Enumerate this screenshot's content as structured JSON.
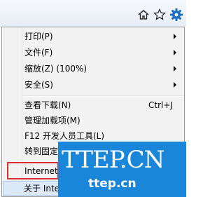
{
  "toolbar": {
    "icons": [
      "home-icon",
      "star-icon",
      "gear-icon"
    ]
  },
  "menu": {
    "items": [
      {
        "label": "打印(P)",
        "shortcut": "",
        "submenu": true
      },
      {
        "label": "文件(F)",
        "shortcut": "",
        "submenu": true
      },
      {
        "label": "缩放(Z) (100%)",
        "shortcut": "",
        "submenu": true
      },
      {
        "label": "安全(S)",
        "shortcut": "",
        "submenu": true
      },
      {
        "label": "查看下载(N)",
        "shortcut": "Ctrl+J",
        "submenu": false
      },
      {
        "label": "管理加载项(M)",
        "shortcut": "",
        "submenu": false
      },
      {
        "label": "F12 开发人员工具(L)",
        "shortcut": "",
        "submenu": false
      },
      {
        "label": "转到固定",
        "shortcut": "",
        "submenu": false
      },
      {
        "label": "Internet",
        "shortcut": "",
        "submenu": false
      },
      {
        "label": "关于 Inte",
        "shortcut": "",
        "submenu": false
      }
    ]
  },
  "watermark": {
    "main": "TTEP.CN",
    "sub": "ttep.cn"
  },
  "colors": {
    "highlight_box": "#d6322f",
    "watermark_bg": "#1a86d9"
  }
}
